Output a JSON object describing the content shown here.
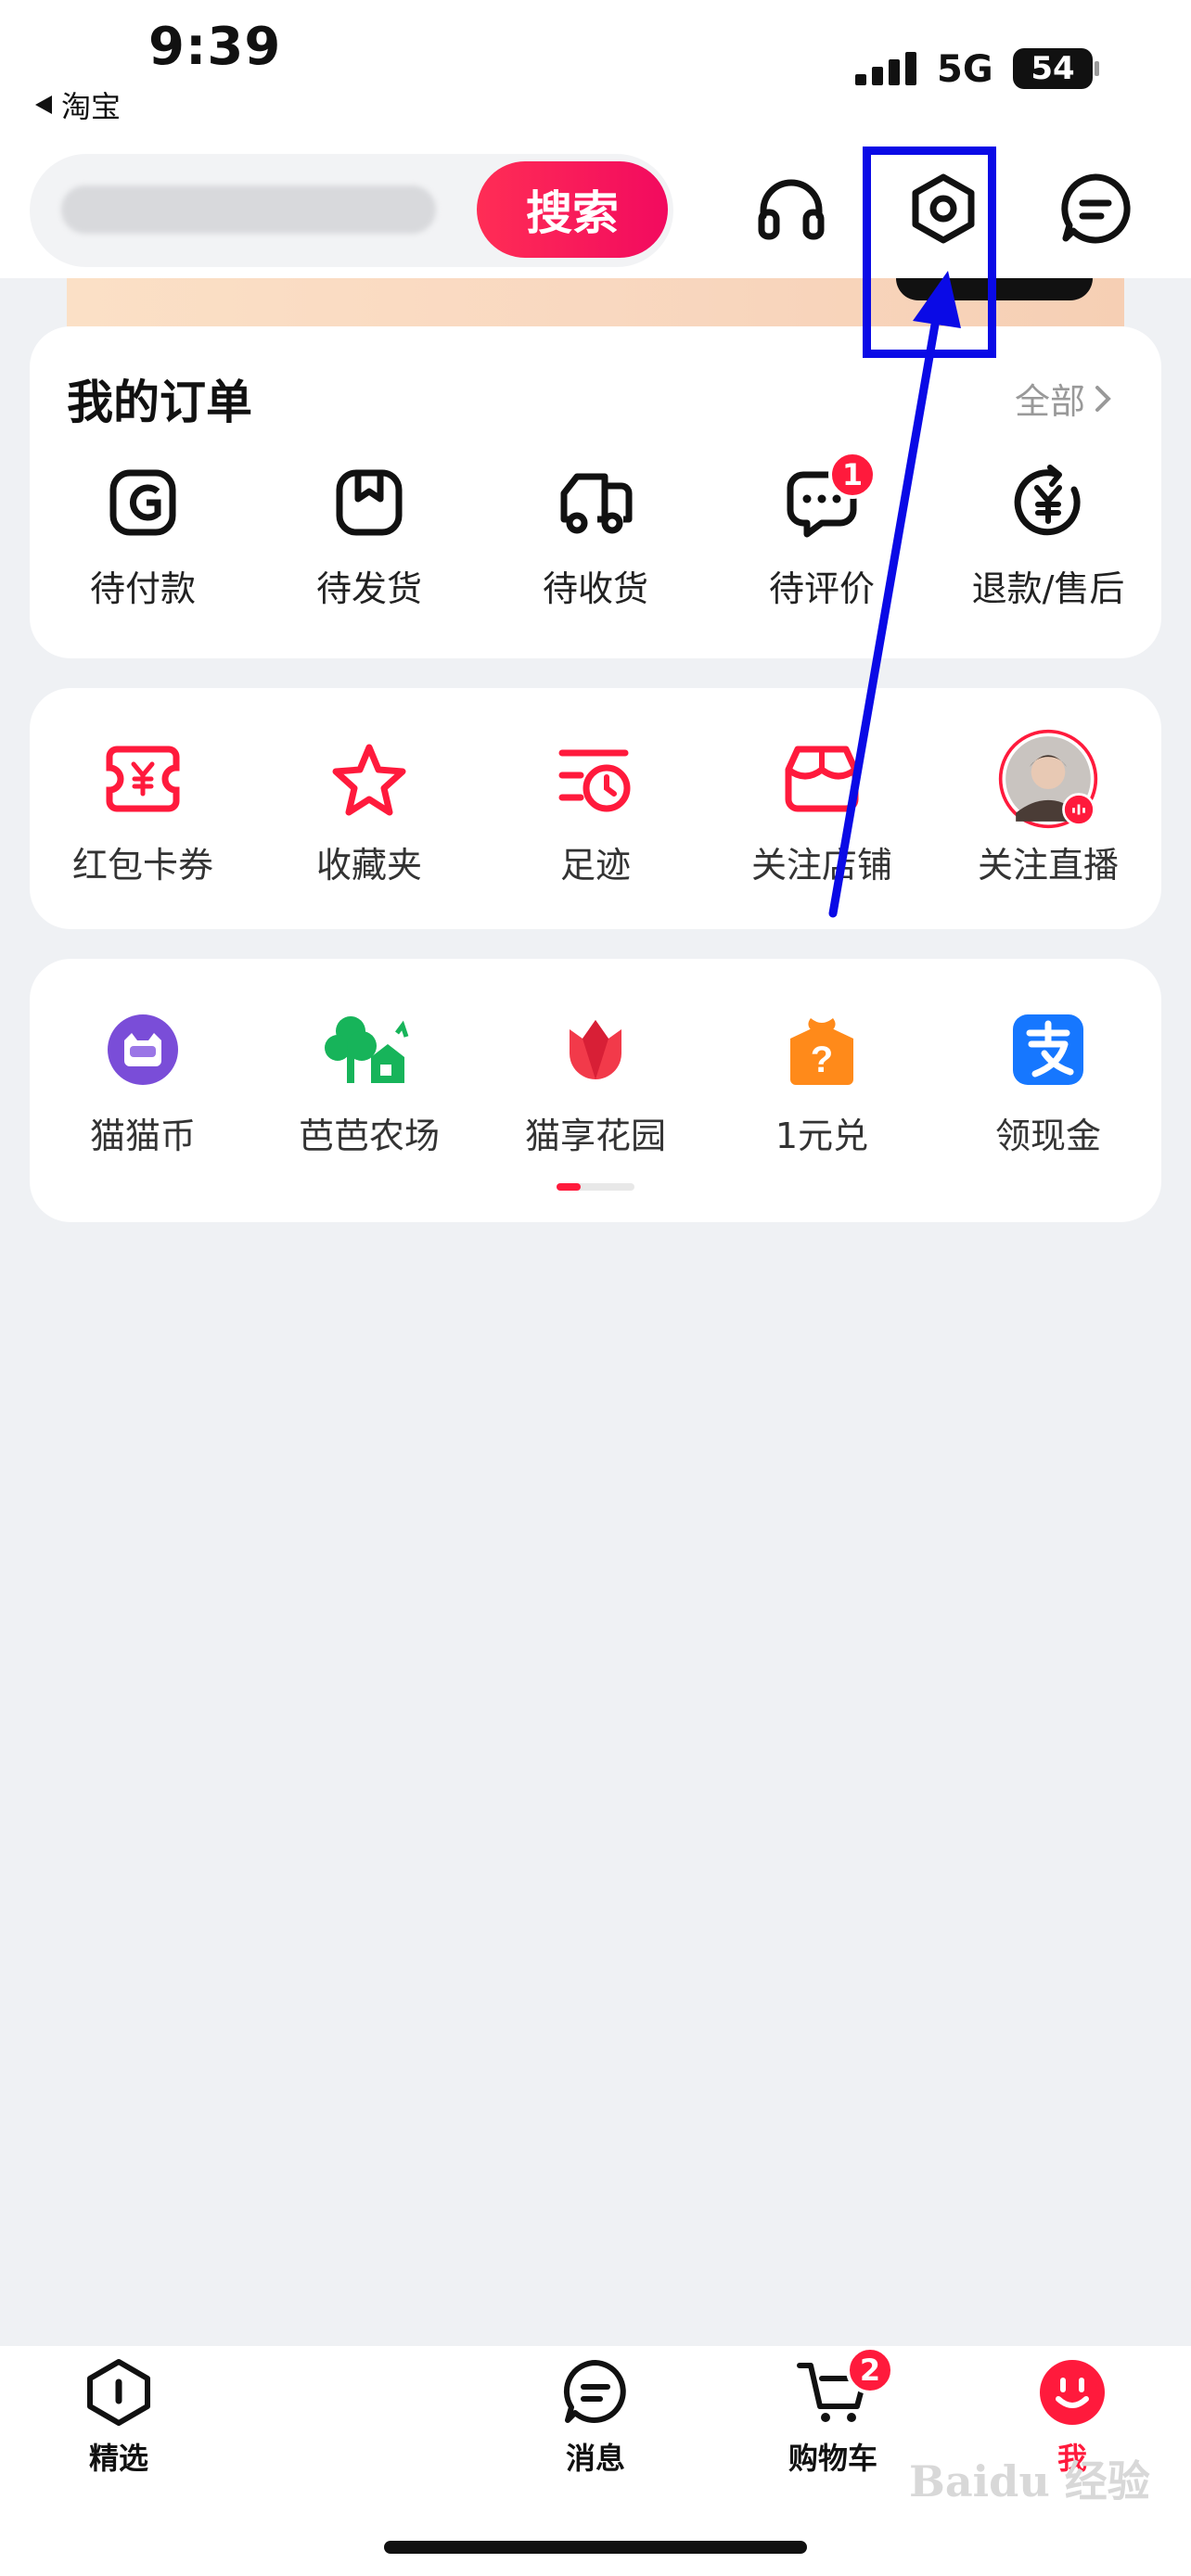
{
  "status_bar": {
    "time": "9:39",
    "back_app": "淘宝",
    "network": "5G",
    "battery": "54"
  },
  "header": {
    "search_button": "搜索"
  },
  "orders": {
    "title": "我的订单",
    "all_label": "全部",
    "items": [
      {
        "label": "待付款",
        "icon": "pending-payment-icon"
      },
      {
        "label": "待发货",
        "icon": "pending-shipment-icon"
      },
      {
        "label": "待收货",
        "icon": "delivery-truck-icon"
      },
      {
        "label": "待评价",
        "icon": "review-chat-icon",
        "badge": "1"
      },
      {
        "label": "退款/售后",
        "icon": "refund-yen-icon"
      }
    ]
  },
  "favorites": {
    "items": [
      {
        "label": "红包卡券",
        "icon": "coupon-icon"
      },
      {
        "label": "收藏夹",
        "icon": "star-icon"
      },
      {
        "label": "足迹",
        "icon": "history-clock-icon"
      },
      {
        "label": "关注店铺",
        "icon": "shop-icon"
      },
      {
        "label": "关注直播",
        "icon": "live-avatar-icon"
      }
    ]
  },
  "services": {
    "items": [
      {
        "label": "猫猫币",
        "icon": "cat-coin-icon"
      },
      {
        "label": "芭芭农场",
        "icon": "farm-tree-icon"
      },
      {
        "label": "猫享花园",
        "icon": "tulip-icon"
      },
      {
        "label": "1元兑",
        "icon": "question-box-icon"
      },
      {
        "label": "领现金",
        "icon": "alipay-icon"
      }
    ],
    "page_indicator": {
      "pages": 2,
      "active": 1
    }
  },
  "tabs": [
    {
      "label": "精选",
      "icon": "home-featured-icon"
    },
    {
      "label": "消息",
      "icon": "message-bubble-icon"
    },
    {
      "label": "购物车",
      "icon": "cart-icon",
      "badge": "2"
    },
    {
      "label": "我",
      "icon": "me-face-icon"
    }
  ],
  "watermark": "Baidu 经验",
  "colors": {
    "accent": "#ff1a3c",
    "annotation": "#0a0ae6",
    "page_bg": "#eff1f4"
  }
}
